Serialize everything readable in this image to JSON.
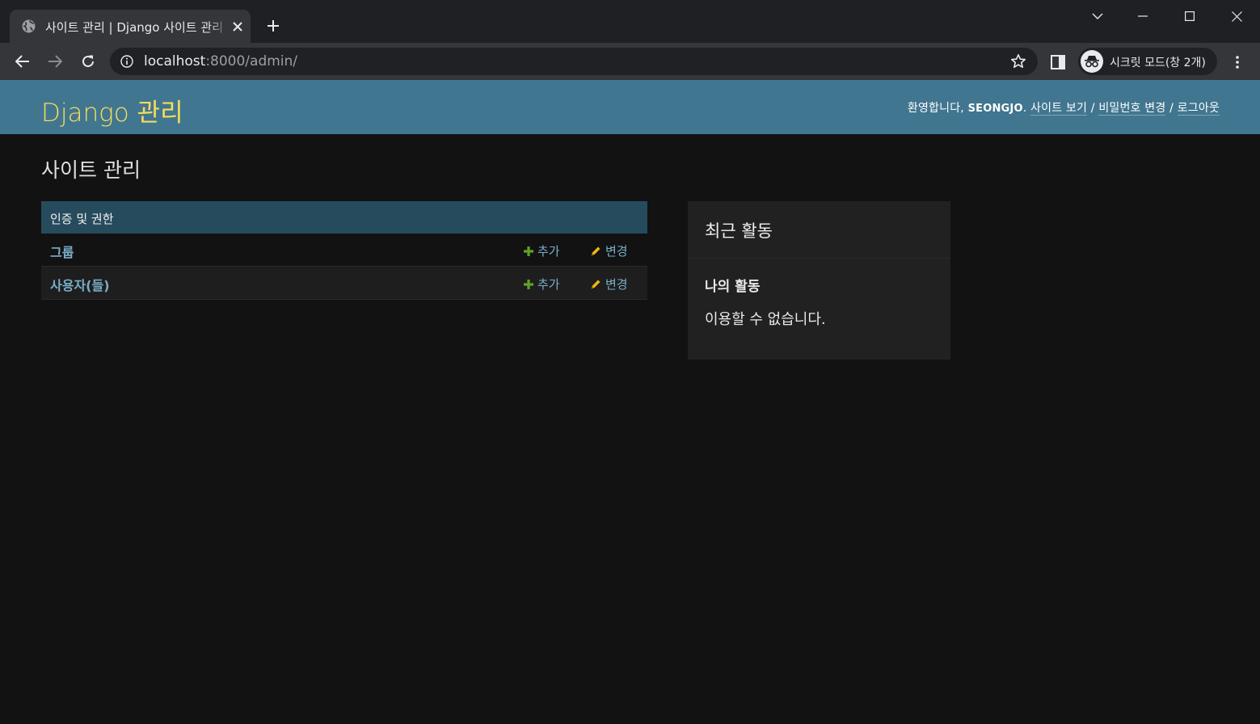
{
  "browser": {
    "tab": {
      "title": "사이트 관리 | Django 사이트 관리"
    },
    "url": {
      "host": "localhost",
      "rest": ":8000/admin/"
    },
    "profile_label": "시크릿 모드(창 2개)"
  },
  "header": {
    "branding": "Django 관리",
    "welcome_prefix": "환영합니다, ",
    "username": "SEONGJO",
    "welcome_suffix": ". ",
    "links": {
      "view_site": "사이트 보기",
      "change_password": "비밀번호 변경",
      "logout": "로그아웃"
    },
    "separator": " / "
  },
  "main": {
    "title": "사이트 관리",
    "app": {
      "caption": "인증 및 권한",
      "models": [
        {
          "name": "그룹",
          "add": "추가",
          "change": "변경"
        },
        {
          "name": "사용자(들)",
          "add": "추가",
          "change": "변경"
        }
      ]
    }
  },
  "recent_actions": {
    "title": "최근 활동",
    "my_actions": "나의 활동",
    "none": "이용할 수 없습니다."
  },
  "colors": {
    "header_bg": "#417690",
    "branding": "#f5dd5d",
    "caption_bg": "#264b5d",
    "link": "#79aec8",
    "add_icon": "#5fa225",
    "change_icon": "#efb80b"
  }
}
